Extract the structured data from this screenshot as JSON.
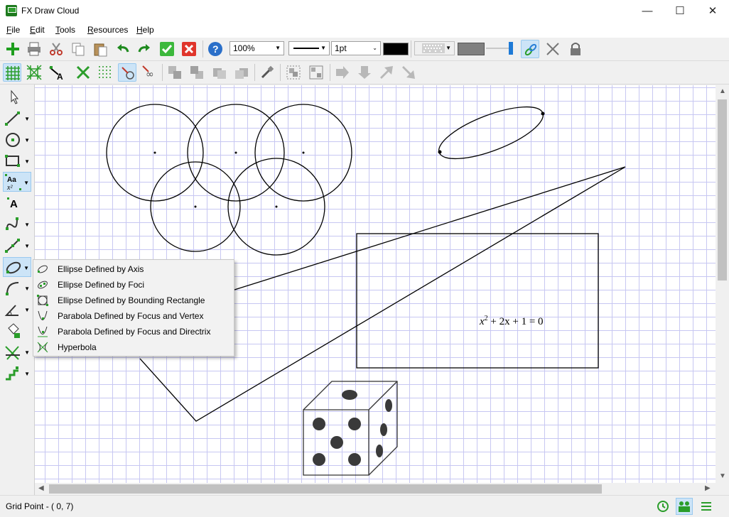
{
  "window": {
    "title": "FX Draw Cloud",
    "minimize": "—",
    "maximize": "☐",
    "close": "✕"
  },
  "menu": [
    "File",
    "Edit",
    "Tools",
    "Resources",
    "Help"
  ],
  "toolbar": {
    "zoom": "100%",
    "line_width": "1pt",
    "line_color": "#000000",
    "fill_color": "#808080",
    "accent_color": "#1e7a1e"
  },
  "shape_menu": {
    "items": [
      "Ellipse Defined by Axis",
      "Ellipse Defined by Foci",
      "Ellipse Defined by Bounding Rectangle",
      "Parabola Defined by Focus and Vertex",
      "Parabola Defined by Focus and Directrix",
      "Hyperbola"
    ]
  },
  "canvas": {
    "equation": {
      "base": "x",
      "exponent": "2",
      "rest": " + 2x + 1  =  0"
    }
  },
  "status": {
    "text": "Grid Point - ( 0, 7)"
  },
  "icons": [
    "new-icon",
    "print-icon",
    "cut-icon",
    "copy-icon",
    "paste-icon",
    "undo-icon",
    "redo-icon",
    "accept-icon",
    "cancel-icon",
    "help-icon",
    "link-icon",
    "unlink-icon",
    "lock-icon",
    "grid-icon",
    "snap-icon",
    "point-label-icon",
    "clear-icon",
    "dots-grid-icon",
    "pointer-icon",
    "line-tool-icon",
    "circle-tool-icon",
    "rectangle-tool-icon",
    "text-tool-icon",
    "curve-tool-icon",
    "ellipse-tool-icon",
    "fill-icon"
  ]
}
